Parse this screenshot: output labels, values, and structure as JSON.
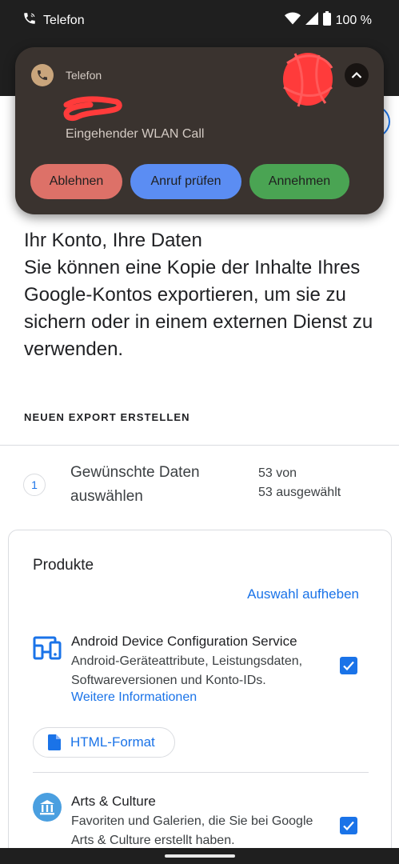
{
  "status_bar": {
    "app_label": "Telefon",
    "icons": [
      "phone-wifi-icon",
      "wifi-icon",
      "signal-icon",
      "battery-icon"
    ],
    "battery": "100 %"
  },
  "notification": {
    "app_name": "Telefon",
    "text": "Eingehender WLAN Call",
    "actions": {
      "decline": "Ablehnen",
      "check": "Anruf prüfen",
      "accept": "Annehmen"
    },
    "colors": {
      "background": "#3a332f",
      "decline": "#dd7168",
      "check": "#5b8df3",
      "accept": "#4aa453"
    }
  },
  "intro": {
    "heading": "Ihr Konto, Ihre Daten",
    "body": "Sie können eine Kopie der Inhalte Ihres Google-Kontos exportieren, um sie zu sichern oder in einem externen Dienst zu verwenden."
  },
  "export": {
    "section_label": "NEUEN EXPORT ERSTELLEN",
    "step": {
      "number": "1",
      "title": "Gewünschte Daten auswählen",
      "count_line1": "53 von",
      "count_line2": "53 ausgewählt"
    }
  },
  "products": {
    "title": "Produkte",
    "deselect": "Auswahl aufheben",
    "items": [
      {
        "name": "Android Device Configuration Service",
        "description": "Android-Geräteattribute, Leistungsdaten, Softwareversionen und Konto-IDs.",
        "link": "Weitere Informationen",
        "format": "HTML-Format",
        "checked": true,
        "icon": "devices-icon"
      },
      {
        "name": "Arts & Culture",
        "description": "Favoriten und Galerien, die Sie bei Google Arts & Culture erstellt haben.",
        "checked": true,
        "icon": "museum-icon"
      }
    ]
  },
  "colors": {
    "accent": "#1a73e8",
    "dark_bar": "#1f1f1f"
  }
}
